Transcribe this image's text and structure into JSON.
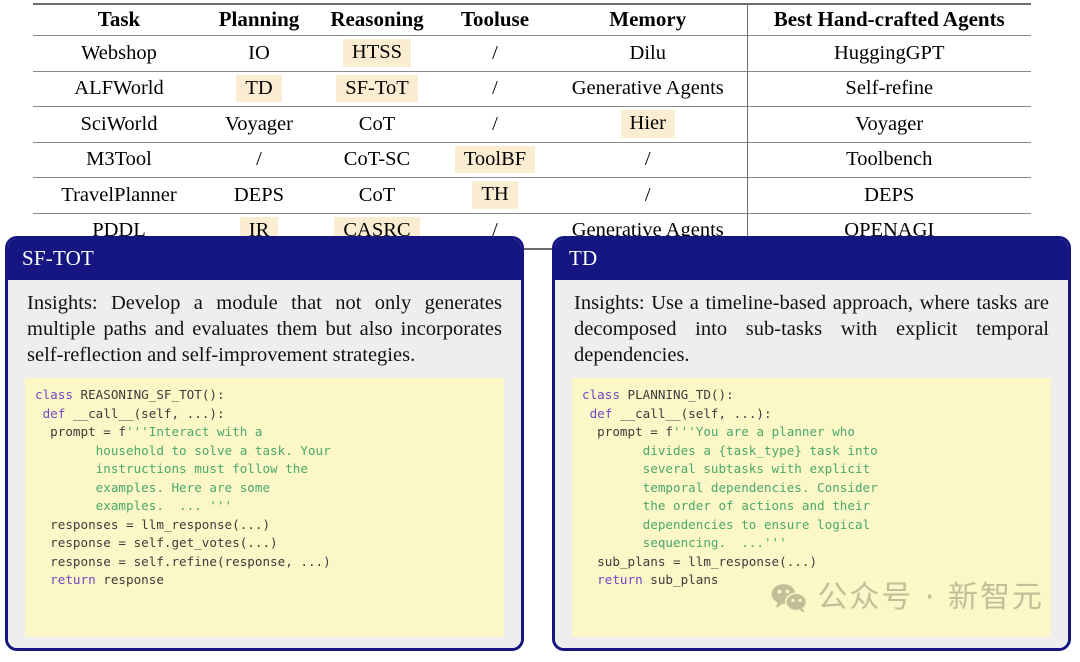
{
  "table": {
    "headers": [
      "Task",
      "Planning",
      "Reasoning",
      "Tooluse",
      "Memory",
      "Best Hand-crafted Agents"
    ],
    "rows": [
      {
        "task": "Webshop",
        "planning": "IO",
        "planning_hl": false,
        "reasoning": "HTSS",
        "reasoning_hl": true,
        "tooluse": "/",
        "tooluse_hl": false,
        "memory": "Dilu",
        "memory_hl": false,
        "best": "HuggingGPT"
      },
      {
        "task": "ALFWorld",
        "planning": "TD",
        "planning_hl": true,
        "reasoning": "SF-ToT",
        "reasoning_hl": true,
        "tooluse": "/",
        "tooluse_hl": false,
        "memory": "Generative Agents",
        "memory_hl": false,
        "best": "Self-refine"
      },
      {
        "task": "SciWorld",
        "planning": "Voyager",
        "planning_hl": false,
        "reasoning": "CoT",
        "reasoning_hl": false,
        "tooluse": "/",
        "tooluse_hl": false,
        "memory": "Hier",
        "memory_hl": true,
        "best": "Voyager"
      },
      {
        "task": "M3Tool",
        "planning": "/",
        "planning_hl": false,
        "reasoning": "CoT-SC",
        "reasoning_hl": false,
        "tooluse": "ToolBF",
        "tooluse_hl": true,
        "memory": "/",
        "memory_hl": false,
        "best": "Toolbench"
      },
      {
        "task": "TravelPlanner",
        "planning": "DEPS",
        "planning_hl": false,
        "reasoning": "CoT",
        "reasoning_hl": false,
        "tooluse": "TH",
        "tooluse_hl": true,
        "memory": "/",
        "memory_hl": false,
        "best": "DEPS"
      },
      {
        "task": "PDDL",
        "planning": "IR",
        "planning_hl": true,
        "reasoning": "CASRC",
        "reasoning_hl": true,
        "tooluse": "/",
        "tooluse_hl": false,
        "memory": "Generative Agents",
        "memory_hl": false,
        "best": "OPENAGI"
      }
    ],
    "highlight_color": "#fbedd2"
  },
  "cards": [
    {
      "title": "SF-TOT",
      "insights": "Insights: Develop a module that not only generates multiple paths and evaluates them but also incorporates self-reflection and self-improvement strategies.",
      "code_lines": [
        [
          {
            "t": "class ",
            "c": "k"
          },
          {
            "t": "REASONING_SF_TOT():",
            "c": "n"
          }
        ],
        [
          {
            "t": " ",
            "c": "n"
          },
          {
            "t": "def ",
            "c": "k"
          },
          {
            "t": "__call__(self, ...):",
            "c": "n"
          }
        ],
        [
          {
            "t": "  prompt = f",
            "c": "n"
          },
          {
            "t": "'''Interact with a",
            "c": "s"
          }
        ],
        [
          {
            "t": "        household to solve a task. Your",
            "c": "s"
          }
        ],
        [
          {
            "t": "        instructions must follow the",
            "c": "s"
          }
        ],
        [
          {
            "t": "        examples. Here are some",
            "c": "s"
          }
        ],
        [
          {
            "t": "        examples.  ... '''",
            "c": "s"
          }
        ],
        [
          {
            "t": "  responses = llm_response(...)",
            "c": "n"
          }
        ],
        [
          {
            "t": "  response = self.get_votes(...)",
            "c": "n"
          }
        ],
        [
          {
            "t": "  response = self.refine(response, ...)",
            "c": "n"
          }
        ],
        [
          {
            "t": "  ",
            "c": "n"
          },
          {
            "t": "return ",
            "c": "k"
          },
          {
            "t": "response",
            "c": "n"
          }
        ]
      ]
    },
    {
      "title": "TD",
      "insights": "Insights: Use a timeline-based approach, where tasks are decomposed into sub-tasks with explicit temporal dependencies.",
      "code_lines": [
        [
          {
            "t": "class ",
            "c": "k"
          },
          {
            "t": "PLANNING_TD():",
            "c": "n"
          }
        ],
        [
          {
            "t": " ",
            "c": "n"
          },
          {
            "t": "def ",
            "c": "k"
          },
          {
            "t": "__call__(self, ...):",
            "c": "n"
          }
        ],
        [
          {
            "t": "  prompt = f",
            "c": "n"
          },
          {
            "t": "'''You are a planner who",
            "c": "s"
          }
        ],
        [
          {
            "t": "        divides a {task_type} task into",
            "c": "s"
          }
        ],
        [
          {
            "t": "        several subtasks with explicit",
            "c": "s"
          }
        ],
        [
          {
            "t": "        temporal dependencies. Consider",
            "c": "s"
          }
        ],
        [
          {
            "t": "        the order of actions and their",
            "c": "s"
          }
        ],
        [
          {
            "t": "        dependencies to ensure logical",
            "c": "s"
          }
        ],
        [
          {
            "t": "        sequencing.  ...'''",
            "c": "s"
          }
        ],
        [
          {
            "t": "  sub_plans = llm_response(...)",
            "c": "n"
          }
        ],
        [
          {
            "t": "  ",
            "c": "n"
          },
          {
            "t": "return ",
            "c": "k"
          },
          {
            "t": "sub_plans",
            "c": "n"
          }
        ]
      ]
    }
  ],
  "watermark": {
    "text": "公众号 · 新智元",
    "icon": "wechat-icon"
  },
  "colors": {
    "card_border": "#161682",
    "card_header_bg": "#161682",
    "card_body_bg": "#eeeeee",
    "code_bg": "#fcf7c6",
    "keyword": "#6c4ac7",
    "string": "#4aa96c",
    "highlight": "#fbedd2"
  }
}
